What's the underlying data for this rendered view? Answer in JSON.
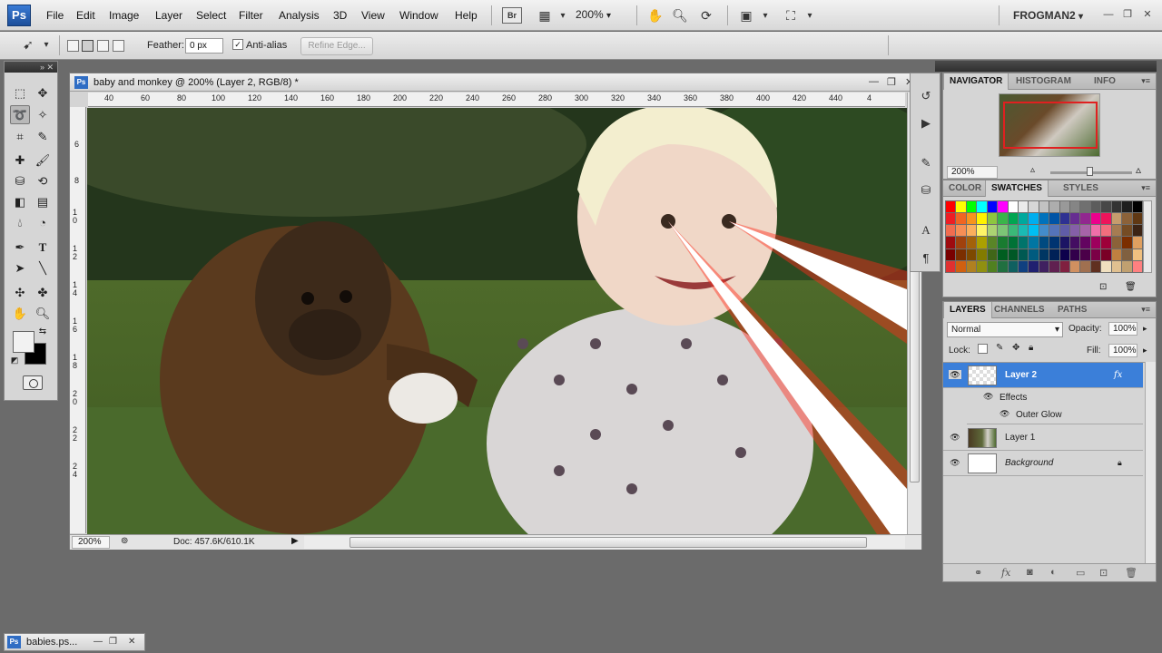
{
  "app": {
    "logo": "Ps"
  },
  "menu": {
    "items": [
      "File",
      "Edit",
      "Image",
      "Layer",
      "Select",
      "Filter",
      "Analysis",
      "3D",
      "View",
      "Window",
      "Help"
    ],
    "bridge_label": "Br",
    "zoom": "200%",
    "workspace": "FROGMAN2"
  },
  "options_bar": {
    "feather_label": "Feather:",
    "feather_value": "0 px",
    "antialias_label": "Anti-alias",
    "antialias_check": "✓",
    "refine_edge_label": "Refine Edge..."
  },
  "document": {
    "title": "baby and monkey @ 200% (Layer 2, RGB/8) *",
    "icon": "Ps",
    "ruler_ticks": [
      "40",
      "60",
      "80",
      "100",
      "120",
      "140",
      "160",
      "180",
      "200",
      "220",
      "240",
      "260",
      "280",
      "300",
      "320",
      "340",
      "360",
      "380",
      "400",
      "420",
      "440",
      "4"
    ],
    "ruler_v_ticks": [
      "6",
      "8",
      "1 0",
      "1 2",
      "1 4",
      "1 6",
      "1 8",
      "2 0",
      "2 2",
      "2 4"
    ],
    "status_zoom": "200%",
    "status_doc": "Doc: 457.6K/610.1K"
  },
  "navigator_panel": {
    "tabs": [
      "NAVIGATOR",
      "HISTOGRAM",
      "INFO"
    ],
    "zoom": "200%"
  },
  "swatches_panel": {
    "tabs": [
      "COLOR",
      "SWATCHES",
      "STYLES"
    ],
    "colors": [
      "#ff0000",
      "#ffff00",
      "#00ff00",
      "#00ffff",
      "#0000ff",
      "#ff00ff",
      "#ffffff",
      "#ebebeb",
      "#d6d6d6",
      "#c2c2c2",
      "#adadad",
      "#999999",
      "#858585",
      "#707070",
      "#5c5c5c",
      "#474747",
      "#333333",
      "#1f1f1f",
      "#000000",
      "#ee1d24",
      "#f16522",
      "#f7941d",
      "#fff200",
      "#8dc63f",
      "#39b54a",
      "#00a651",
      "#00a99d",
      "#00aeef",
      "#0072bc",
      "#0054a6",
      "#2e3192",
      "#662d91",
      "#92278f",
      "#ec008c",
      "#ed145b",
      "#c69c6d",
      "#8c6239",
      "#603813",
      "#f26c4f",
      "#f68e55",
      "#fbaf5c",
      "#fff467",
      "#acd372",
      "#7cc576",
      "#3bb878",
      "#1abbb4",
      "#00bff3",
      "#438ccb",
      "#5574b9",
      "#605ca8",
      "#855fa8",
      "#a763a8",
      "#f06ea9",
      "#f26d7d",
      "#a67c52",
      "#754c24",
      "#3c2415",
      "#9e0b0f",
      "#a0410d",
      "#a3620a",
      "#aba000",
      "#598527",
      "#197b30",
      "#007236",
      "#00746b",
      "#0076a3",
      "#004a80",
      "#003471",
      "#1b1464",
      "#440e62",
      "#630460",
      "#9e005d",
      "#9e0039",
      "#8b6239",
      "#7b2e00",
      "#e0a060",
      "#790000",
      "#7b2e00",
      "#7d4900",
      "#827b00",
      "#406618",
      "#005e20",
      "#005826",
      "#005952",
      "#005b7f",
      "#003663",
      "#002157",
      "#0d004c",
      "#32004b",
      "#4b0049",
      "#7b0046",
      "#7a0026",
      "#c08040",
      "#806040",
      "#f0c080",
      "#e03030",
      "#d06010",
      "#b08020",
      "#909010",
      "#508020",
      "#207040",
      "#106060",
      "#104080",
      "#202070",
      "#402060",
      "#602050",
      "#802040",
      "#d09060",
      "#a07050",
      "#603020",
      "#f0e0c0",
      "#e0c090",
      "#c0a070",
      "#ff8080"
    ]
  },
  "layers_panel": {
    "tabs": [
      "LAYERS",
      "CHANNELS",
      "PATHS"
    ],
    "blend_mode": "Normal",
    "opacity_label": "Opacity:",
    "opacity": "100%",
    "lock_label": "Lock:",
    "fill_label": "Fill:",
    "fill": "100%",
    "layers": [
      {
        "name": "Layer 2",
        "fx": "fx"
      },
      {
        "name": "Effects"
      },
      {
        "name": "Outer Glow"
      },
      {
        "name": "Layer 1"
      },
      {
        "name": "Background"
      }
    ]
  },
  "taskbar": {
    "minimized_doc": "babies.ps..."
  }
}
